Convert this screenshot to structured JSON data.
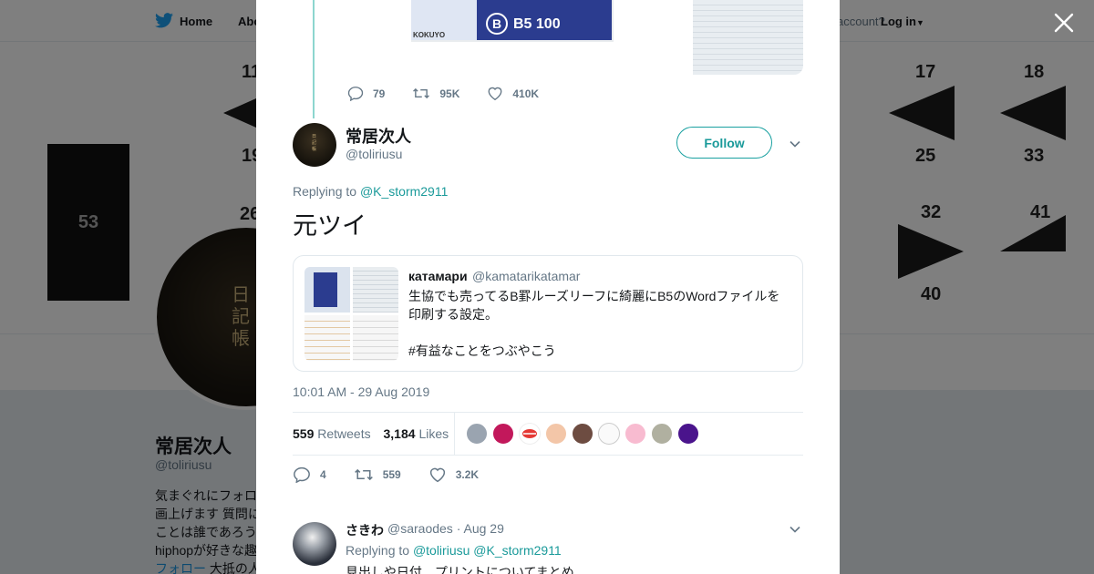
{
  "background": {
    "nav": {
      "home": "Home",
      "about": "Abo",
      "have_account": "account?",
      "login": "Log in"
    },
    "banner": {
      "box_number": "53",
      "numbers": [
        "11",
        "19",
        "26",
        "17",
        "18",
        "25",
        "33",
        "32",
        "41",
        "40"
      ]
    },
    "avatar_text": "日記帳",
    "profile": {
      "name": "常居次人",
      "handle": "@toliriusu",
      "bio_lines": [
        "気まぐれにフォロ",
        "画上げます 質問に",
        "ことは誰であろう",
        "hiphopが好きな趣",
        "フォロー 大抵の人"
      ],
      "bio_link": "フォロー"
    }
  },
  "modal": {
    "parent_tweet": {
      "pack_brand": "KOKUYO",
      "pack_letter": "B",
      "pack_text": "B5 100",
      "actions": {
        "replies": "79",
        "retweets": "95K",
        "likes": "410K"
      }
    },
    "tweet": {
      "author_name": "常居次人",
      "author_handle": "@toliriusu",
      "follow_label": "Follow",
      "replying_prefix": "Replying to",
      "replying_to": "@K_storm2911",
      "text": "元ツイ",
      "quote": {
        "name": "катамари",
        "handle": "@kamatarikatamar",
        "text_line1": "生協でも売ってるB罫ルーズリーフに綺麗にB5のWordファイルを印刷する設定。",
        "text_line2": "#有益なことをつぶやこう"
      },
      "timestamp": "10:01 AM - 29 Aug 2019",
      "retweet_count": "559",
      "retweet_label": "Retweets",
      "like_count": "3,184",
      "like_label": "Likes",
      "liker_colors": [
        "#9aa4b0",
        "#c2185b",
        "#e53935",
        "#f3c6a8",
        "#6d4c41",
        "#ffffff",
        "#f8bbd0",
        "#b0b0a0",
        "#4a148c"
      ],
      "actions": {
        "replies": "4",
        "retweets": "559",
        "likes": "3.2K"
      }
    },
    "reply": {
      "name": "さきわ",
      "handle": "@saraodes",
      "date": "· Aug 29",
      "replying_prefix": "Replying to",
      "replying_to_1": "@toliriusu",
      "replying_to_2": "@K_storm2911",
      "text": "見出しや日付、プリントについてまとめ"
    }
  },
  "colors": {
    "accent": "#1a9a9a",
    "thread_line": "#8cd6cf",
    "twitter_blue": "#1da1f2"
  }
}
